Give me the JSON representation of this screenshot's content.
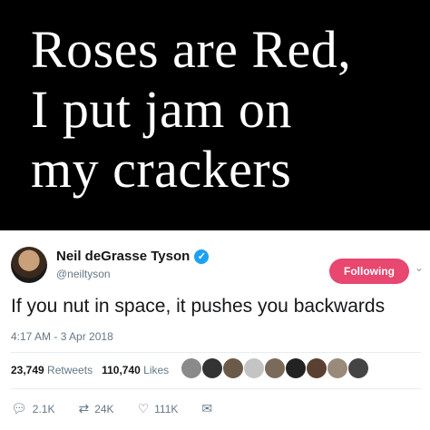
{
  "caption": {
    "lines": [
      "Roses are Red,",
      "I put jam on",
      "my crackers"
    ]
  },
  "tweet": {
    "author_name": "Neil deGrasse Tyson",
    "handle": "@neiltyson",
    "follow_label": "Following",
    "text": "If you nut in space, it pushes you backwards",
    "timestamp": "4:17 AM - 3 Apr 2018",
    "retweets_count": "23,749",
    "retweets_label": "Retweets",
    "likes_count": "110,740",
    "likes_label": "Likes",
    "reply_count": "2.1K",
    "retweet_action_count": "24K",
    "like_action_count": "111K"
  },
  "colors": {
    "follow_button": "#e8476f",
    "verified": "#1da1f2"
  }
}
